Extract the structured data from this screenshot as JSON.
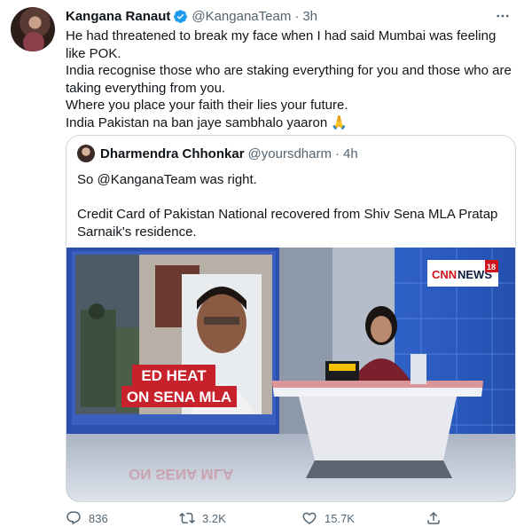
{
  "tweet": {
    "author_name": "Kangana Ranaut",
    "handle": "@KanganaTeam",
    "time": "3h",
    "lines": [
      "He had threatened to break my face when I had said Mumbai was feeling like POK.",
      "India recognise those who are staking everything for you and those who are taking everything from you.",
      "Where you place your faith their lies your future.",
      "India Pakistan na ban jaye sambhalo yaaron"
    ],
    "emoji": "🙏"
  },
  "quoted": {
    "author_name": "Dharmendra Chhonkar",
    "handle": "@yoursdharm",
    "time": "4h",
    "line1": "So @KanganaTeam was right.",
    "line2": "Credit Card of Pakistan National recovered from Shiv Sena MLA Pratap Sarnaik's residence.",
    "media": {
      "headline_1": "ED HEAT",
      "headline_2": "ON SENA MLA",
      "channel_a": "CNN",
      "channel_b": "NEWS",
      "channel_num": "18",
      "reflection": "ON SENA MLA"
    }
  },
  "actions": {
    "replies": "836",
    "retweets": "3.2K",
    "likes": "15.7K"
  },
  "icons": {
    "verified": "verified-badge-icon",
    "more": "more-icon",
    "reply": "reply-icon",
    "retweet": "retweet-icon",
    "like": "heart-icon",
    "share": "share-icon"
  },
  "colors": {
    "verified": "#1d9bf0",
    "muted": "#536471",
    "border": "#cfd9de"
  }
}
